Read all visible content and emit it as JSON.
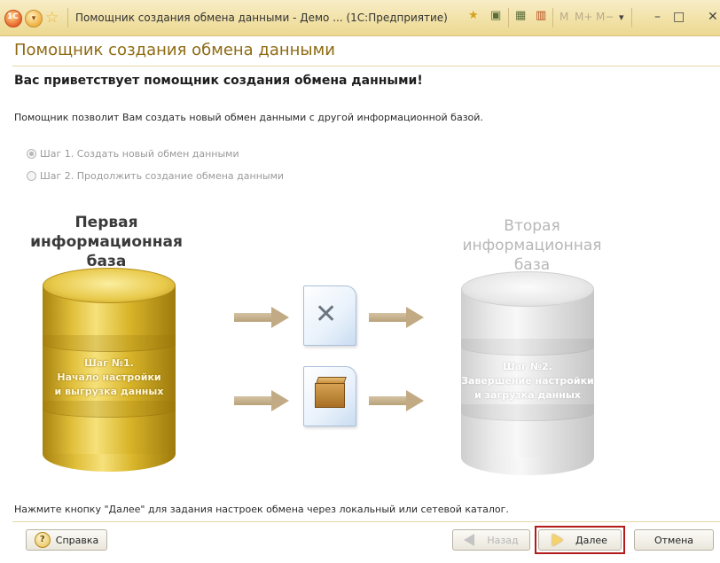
{
  "window": {
    "title": "Помощник создания обмена данными - Демо ... (1С:Предприятие)",
    "logo_text": "1С",
    "memory_buttons": [
      "M",
      "M+",
      "M−"
    ]
  },
  "page": {
    "title": "Помощник создания обмена данными",
    "welcome": "Вас приветствует помощник создания обмена данными!",
    "description": "Помощник позволит Вам создать новый обмен данными с другой информационной базой.",
    "steps": [
      {
        "label": "Шаг 1. Создать новый обмен данными",
        "selected": true
      },
      {
        "label": "Шаг 2. Продолжить создание обмена данными",
        "selected": false
      }
    ]
  },
  "diagram": {
    "first_db": {
      "title_lines": [
        "Первая",
        "информационная",
        "база"
      ],
      "caption_lines": [
        "Шаг №1.",
        "Начало настройки",
        "и выгрузка данных"
      ]
    },
    "second_db": {
      "title_lines": [
        "Вторая",
        "информационная",
        "база"
      ],
      "caption_lines": [
        "Шаг №2.",
        "Завершение настройки",
        "и загрузка данных"
      ]
    }
  },
  "footer": {
    "hint": "Нажмите кнопку \"Далее\" для задания настроек обмена через локальный или сетевой каталог.",
    "help_label": "Справка",
    "back_label": "Назад",
    "next_label": "Далее",
    "cancel_label": "Отмена"
  },
  "colors": {
    "title_text": "#8e6a12",
    "highlight": "#b31a1a"
  }
}
